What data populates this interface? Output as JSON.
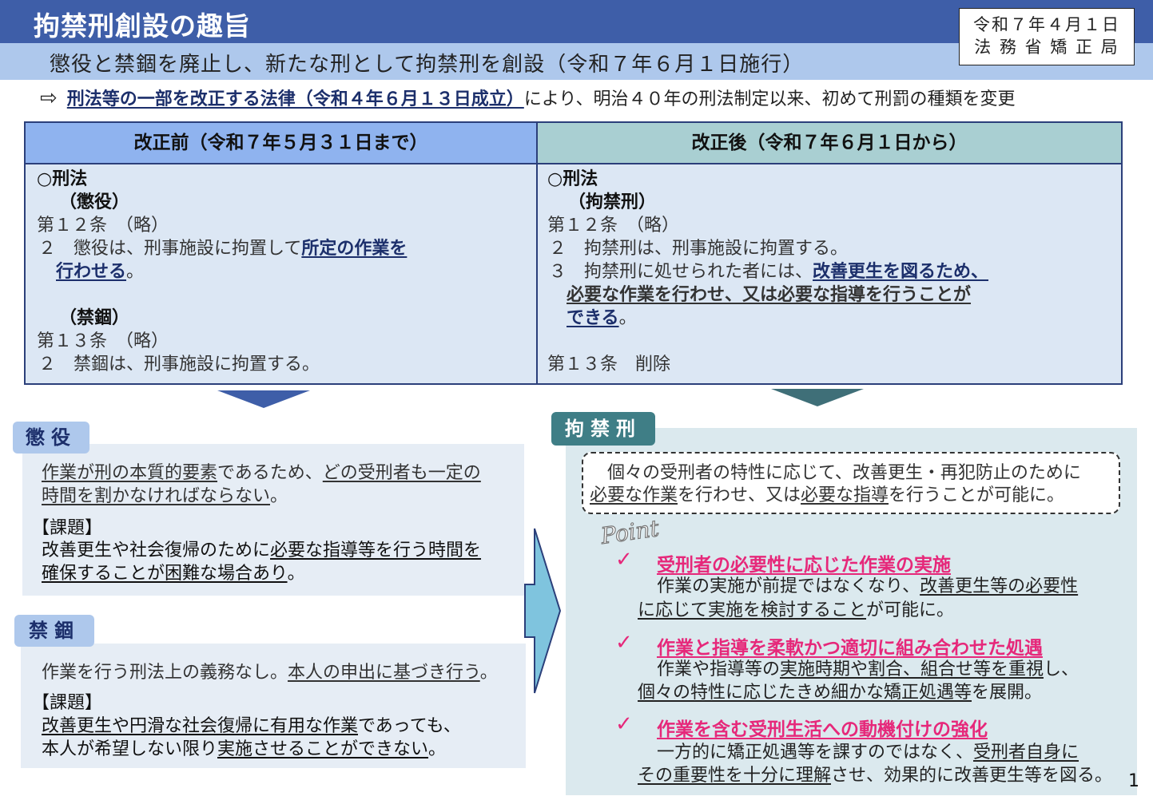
{
  "header": {
    "title": "拘禁刑創設の趣旨",
    "subtitle": "懲役と禁錮を廃止し、新たな刑として拘禁刑を創設（令和７年６月１日施行）",
    "date_line1": "令和７年４月１日",
    "date_line2": "法 務 省 矯 正 局"
  },
  "law_line": {
    "arrow": "⇨",
    "law_name": "刑法等の一部を改正する法律（令和４年６月１３日成立）",
    "rest": "により、明治４０年の刑法制定以来、初めて刑罰の種類を変更"
  },
  "before": {
    "head": "改正前（令和７年５月３１日まで）",
    "keiho": "○刑法",
    "choeki_head": "（懲役）",
    "art12": "第１２条　（略）",
    "art12_2a": "２　懲役は、刑事施設に拘置して",
    "art12_2b": "所定の作業を",
    "art12_2c": "行わせる",
    "art12_2d": "。",
    "kinko_head": "（禁錮）",
    "art13": "第１３条　（略）",
    "art13_2": "２　禁錮は、刑事施設に拘置する。"
  },
  "after": {
    "head": "改正後（令和７年６月１日から）",
    "keiho": "○刑法",
    "kohkin_head": "（拘禁刑）",
    "art12": "第１２条　（略）",
    "art12_2": "２　拘禁刑は、刑事施設に拘置する。",
    "art12_3a": "３　拘禁刑に処せられた者には、",
    "art12_3b": "改善更生を図るため、",
    "art12_3c": "必要な作業を行わせ、又は必要な指導を行うことが",
    "art12_3d": "できる",
    "art12_3e": "。",
    "art13": "第１３条　削除"
  },
  "choeki": {
    "tag": "懲役",
    "line1a": "作業が刑の本質的要素",
    "line1b": "であるため、",
    "line1c": "どの受刑者も一定の",
    "line2": "時間を割かなければならない",
    "line2end": "。",
    "issue_label": "【課題】",
    "issue1a": "改善更生や社会復帰のために",
    "issue1b": "必要な指導等を行う時間を",
    "issue2": "確保することが困難な場合あり",
    "issue2end": "。"
  },
  "kinko": {
    "tag": "禁錮",
    "line1a": "作業を行う刑法上の義務なし。",
    "line1b": "本人の申出に基づき行う",
    "line1c": "。",
    "issue_label": "【課題】",
    "issue1a": "改善更生や円滑な社会復帰に有用な作業",
    "issue1b": "であっても、",
    "issue2a": "本人が希望しない限り",
    "issue2b": "実施させることができない",
    "issue2c": "。"
  },
  "kohkin": {
    "tag": "拘禁刑",
    "summary1": "個々の受刑者の特性に応じて、改善更生・再犯防止のために",
    "summary2a": "必要な作業",
    "summary2b": "を行わせ、又は",
    "summary2c": "必要な指導",
    "summary2d": "を行うことが可能に。",
    "point_word": "Point",
    "check_icon": "✓",
    "p1_head": "受刑者の必要性に応じた作業の実施",
    "p1_line1a": "作業の実施が前提ではなくなり、",
    "p1_line1b": "改善更生等の必要性",
    "p1_line2a": "に応じて実施を検討すること",
    "p1_line2b": "が可能に。",
    "p2_head": "作業と指導を柔軟かつ適切に組み合わせた処遇",
    "p2_line1a": "作業や指導等の",
    "p2_line1b": "実施時期や割合、組合せ等を重視",
    "p2_line1c": "し、",
    "p2_line2a": "個々の特性に応じたきめ細かな矯正処遇等",
    "p2_line2b": "を展開。",
    "p3_head": "作業を含む受刑生活への動機付けの強化",
    "p3_line1a": "一方的に矯正処遇等を課すのではなく、",
    "p3_line1b": "受刑者自身に",
    "p3_line2a": "その重要性を十分に理解",
    "p3_line2b": "させ、効果的に改善更生等を図る。"
  },
  "page_number": "1"
}
